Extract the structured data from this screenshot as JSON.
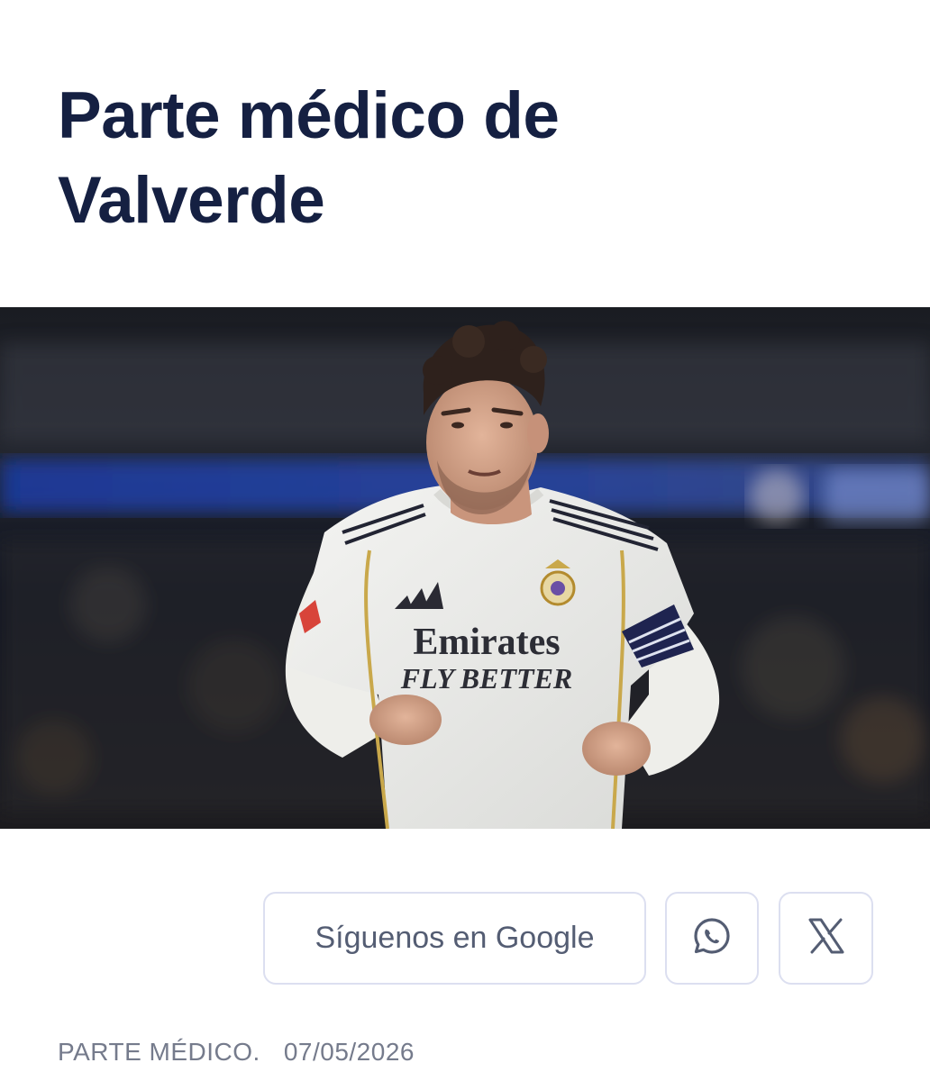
{
  "article": {
    "title_line1": "Parte médico de",
    "title_line2": "Valverde",
    "category": "PARTE MÉDICO.",
    "date": "07/05/2026"
  },
  "hero": {
    "image_alt": "player-photo",
    "sponsor_line1": "Emirates",
    "sponsor_line2": "FLY BETTER"
  },
  "share": {
    "follow_label": "Síguenos en Google",
    "whatsapp_icon": "whatsapp-icon",
    "x_icon": "x-icon"
  },
  "colors": {
    "title": "#152042",
    "button_border": "#dcdff0",
    "button_text": "#545d73",
    "meta_text": "#757b8c"
  }
}
